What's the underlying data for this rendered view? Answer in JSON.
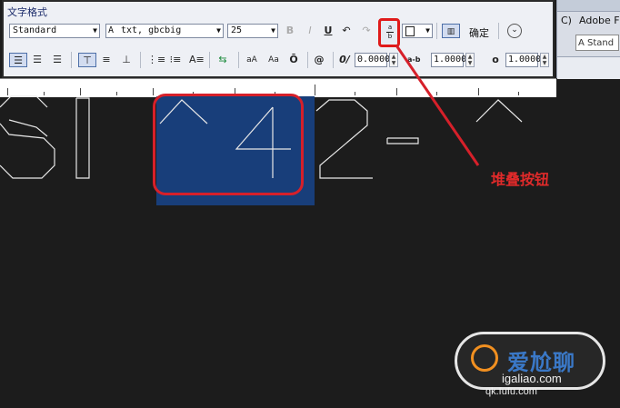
{
  "toolbar": {
    "title": "文字格式",
    "style_value": "Standard",
    "font_value": "txt, gbcbig",
    "height_value": "25",
    "bold_label": "B",
    "italic_label": "I",
    "underline_label": "U",
    "undo_label": "↶",
    "redo_label": "↷",
    "stack_top": "a",
    "stack_bottom": "b",
    "ok_label": "确定",
    "oblique_label": "0/",
    "oblique_value": "0.0000",
    "tracking_label": "a-b",
    "tracking_value": "1.0000",
    "width_label": "o",
    "width_value": "1.0000",
    "symbol_label": "@",
    "upper_label": "aA",
    "lower_label": "Aa",
    "overline_label": "Ō"
  },
  "background_app": {
    "menu_partial": "C)",
    "adobe_label": "Adobe F",
    "style_partial": "Stand"
  },
  "annotation": {
    "callout_text": "堆叠按钮"
  },
  "watermark": {
    "brand": "爱尬聊",
    "url": "igaliao.com",
    "sub": "qk.fufu.com"
  }
}
